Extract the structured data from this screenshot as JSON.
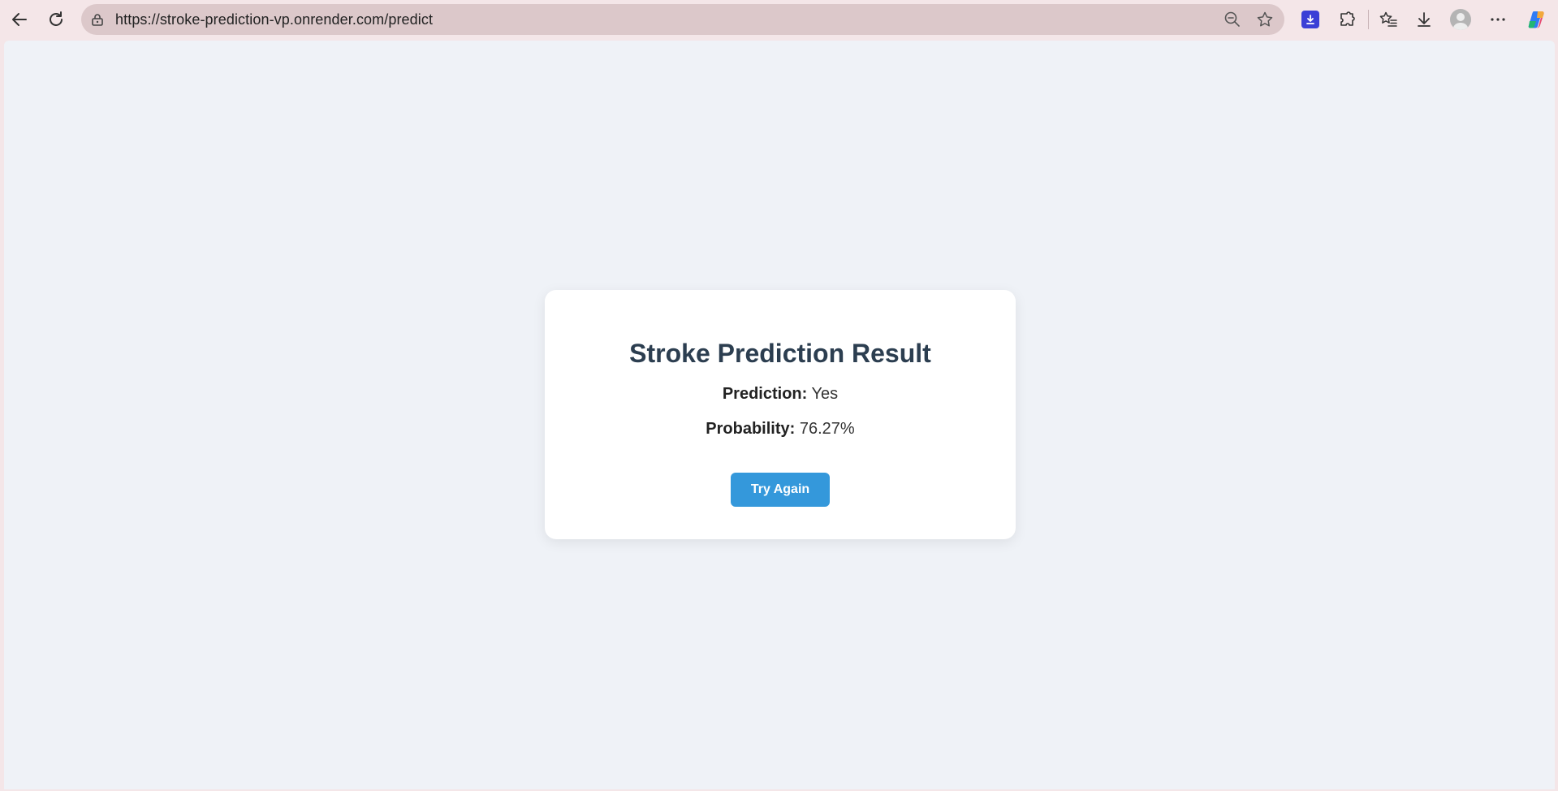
{
  "browser": {
    "url": "https://stroke-prediction-vp.onrender.com/predict",
    "icons": {
      "back": "back-arrow-icon",
      "reload": "reload-icon",
      "site_info": "site-info-lock-icon",
      "zoom": "zoom-out-icon",
      "favorite": "star-icon",
      "extension_download": "download-extension-icon",
      "extensions": "puzzle-icon",
      "favorites": "favorites-list-icon",
      "downloads": "download-icon",
      "profile": "profile-avatar-icon",
      "more": "more-icon",
      "copilot": "copilot-icon"
    }
  },
  "result": {
    "title": "Stroke Prediction Result",
    "prediction_label": "Prediction:",
    "prediction_value": "Yes",
    "probability_label": "Probability:",
    "probability_value": "76.27%",
    "button_label": "Try Again"
  },
  "colors": {
    "accent": "#3498db",
    "title": "#2c3e50",
    "page_background": "#eff2f7",
    "browser_chrome": "#f4e6e8"
  }
}
